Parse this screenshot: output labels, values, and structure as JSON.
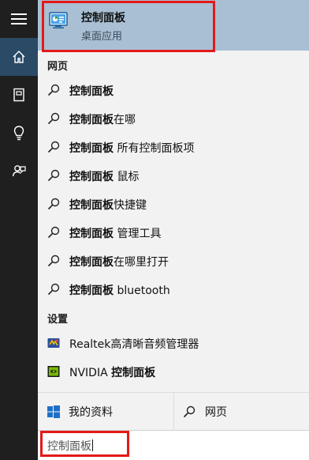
{
  "best_match": {
    "title": "控制面板",
    "subtitle": "桌面应用",
    "icon": "control-panel-icon"
  },
  "web_section": {
    "label": "网页",
    "items": [
      {
        "bold": "控制面板",
        "rest": ""
      },
      {
        "bold": "控制面板",
        "rest": "在哪"
      },
      {
        "bold": "控制面板",
        "rest": " 所有控制面板项"
      },
      {
        "bold": "控制面板",
        "rest": " 鼠标"
      },
      {
        "bold": "控制面板",
        "rest": "快捷键"
      },
      {
        "bold": "控制面板",
        "rest": " 管理工具"
      },
      {
        "bold": "控制面板",
        "rest": "在哪里打开"
      },
      {
        "bold": "控制面板",
        "rest": " bluetooth"
      }
    ]
  },
  "settings_section": {
    "label": "设置",
    "items": [
      {
        "pre": "Realtek高清晰音频管理器",
        "bold": "",
        "icon": "realtek-audio-icon"
      },
      {
        "pre": "NVIDIA ",
        "bold": "控制面板",
        "icon": "nvidia-icon"
      }
    ]
  },
  "bottom_bar": {
    "my_stuff": "我的资料",
    "web": "网页"
  },
  "search": {
    "value": "控制面板"
  },
  "colors": {
    "rail": "#1f1f1f",
    "rail_active": "#2a4a66",
    "best_match_bg": "#a9c0d4",
    "highlight_box": "#e31919"
  }
}
